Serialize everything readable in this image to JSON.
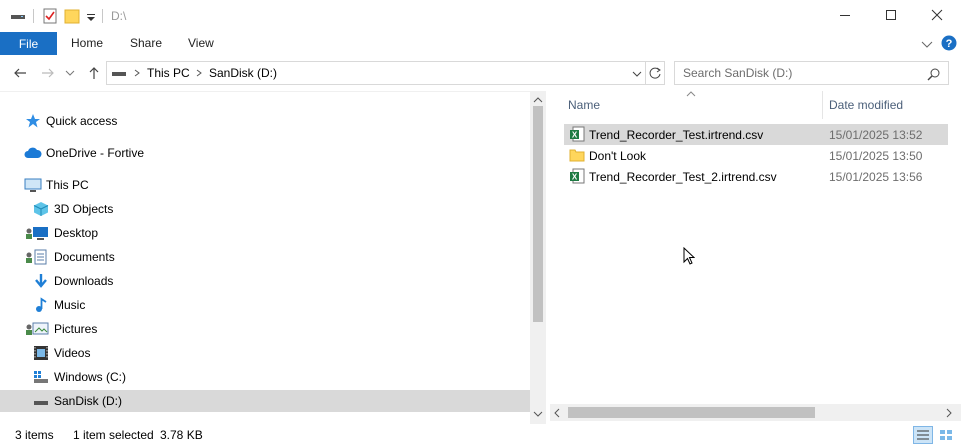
{
  "window": {
    "title": "D:\\",
    "colors": {
      "accent": "#1a6fc4",
      "selection": "#d9d9d9",
      "header_text": "#4c607a"
    }
  },
  "ribbon": {
    "file_label": "File",
    "tabs": [
      "Home",
      "Share",
      "View"
    ]
  },
  "address": {
    "crumbs": [
      "This PC",
      "SanDisk (D:)"
    ],
    "search_placeholder": "Search SanDisk (D:)"
  },
  "nav": {
    "items": [
      {
        "label": "Quick access",
        "icon": "star-icon"
      },
      {
        "label": "OneDrive - Fortive",
        "icon": "cloud-icon"
      },
      {
        "label": "This PC",
        "icon": "computer-icon"
      },
      {
        "label": "3D Objects",
        "icon": "cube-icon"
      },
      {
        "label": "Desktop",
        "icon": "desktop-icon"
      },
      {
        "label": "Documents",
        "icon": "documents-icon"
      },
      {
        "label": "Downloads",
        "icon": "download-icon"
      },
      {
        "label": "Music",
        "icon": "music-icon"
      },
      {
        "label": "Pictures",
        "icon": "pictures-icon"
      },
      {
        "label": "Videos",
        "icon": "videos-icon"
      },
      {
        "label": "Windows (C:)",
        "icon": "drive-icon"
      },
      {
        "label": "SanDisk (D:)",
        "icon": "usb-drive-icon"
      }
    ]
  },
  "files": {
    "columns": {
      "name": "Name",
      "date": "Date modified"
    },
    "rows": [
      {
        "name": "Trend_Recorder_Test.irtrend.csv",
        "date": "15/01/2025 13:52",
        "icon": "excel-csv-icon"
      },
      {
        "name": "Don't Look",
        "date": "15/01/2025 13:50",
        "icon": "folder-icon"
      },
      {
        "name": "Trend_Recorder_Test_2.irtrend.csv",
        "date": "15/01/2025 13:56",
        "icon": "excel-csv-icon"
      }
    ]
  },
  "status": {
    "item_count": "3 items",
    "selected": "1 item selected",
    "size": "3.78 KB"
  }
}
